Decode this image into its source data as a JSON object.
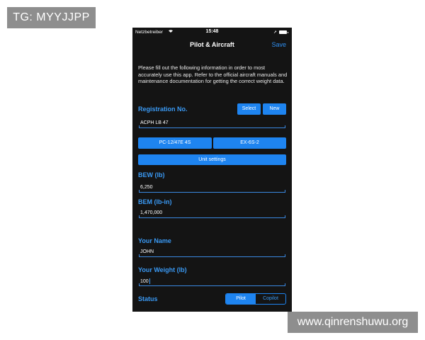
{
  "watermarks": {
    "top_left": "TG: MYYJJPP",
    "bottom_right": "www.qinrenshuwu.org"
  },
  "statusbar": {
    "carrier": "Netzbetreiber",
    "time": "15:48",
    "icons": [
      "wifi-icon",
      "location-arrow-icon",
      "battery-icon"
    ]
  },
  "navbar": {
    "title": "Pilot & Aircraft",
    "save_label": "Save"
  },
  "intro_text": "Please fill out the following information in order to most accurately use this app. Refer to the official aircraft manuals and maintenance documentation for getting the correct weight data.",
  "registration": {
    "label": "Registration No.",
    "select_label": "Select",
    "new_label": "New",
    "value": "ACPH LB 47"
  },
  "aircraft_buttons": [
    "PC-12/47E 4S",
    "EX-6S-2"
  ],
  "unit_settings_label": "Unit settings",
  "bew": {
    "label": "BEW (lb)",
    "value": "6,250"
  },
  "bem": {
    "label": "BEM (lb-in)",
    "value": "1,470,000"
  },
  "your_name": {
    "label": "Your Name",
    "value": "JOHN"
  },
  "your_weight": {
    "label": "Your Weight (lb)",
    "value": "100"
  },
  "status": {
    "label": "Status",
    "options": [
      "Pilot",
      "Copilot"
    ],
    "selected": "Pilot"
  },
  "colors": {
    "accent": "#1e84f0",
    "label_blue": "#3a9af5",
    "background": "#141414"
  }
}
